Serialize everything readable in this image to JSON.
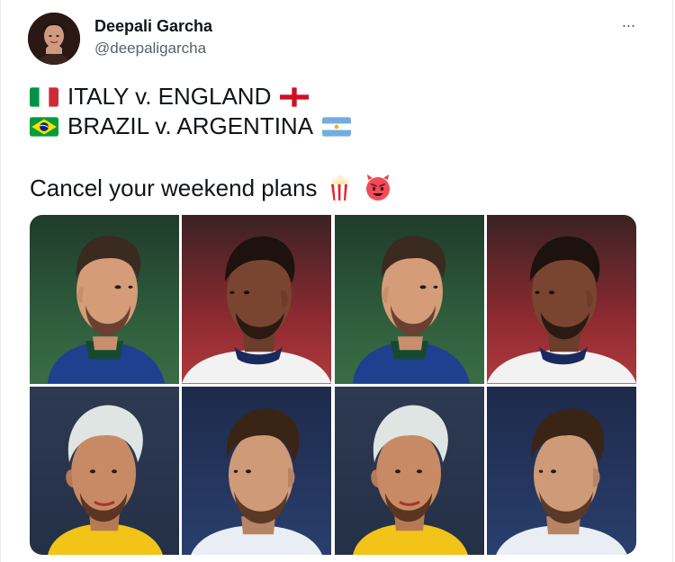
{
  "tweet": {
    "author_name": "Deepali Garcha",
    "author_handle": "@deepaligarcha",
    "more_label": "···",
    "line1_text": "ITALY v. ENGLAND",
    "line2_text": "BRAZIL v. ARGENTINA",
    "line3_text": "Cancel your weekend plans"
  },
  "icons": {
    "flag_italy": "flag-italy-icon",
    "flag_england": "flag-england-icon",
    "flag_brazil": "flag-brazil-icon",
    "flag_argentina": "flag-argentina-icon",
    "popcorn": "popcorn-icon",
    "devil": "smiling-face-with-horns-icon",
    "more": "more-options-icon"
  },
  "colors": {
    "text_primary": "#0f1419",
    "text_secondary": "#536471",
    "border": "#e6ecf0"
  }
}
